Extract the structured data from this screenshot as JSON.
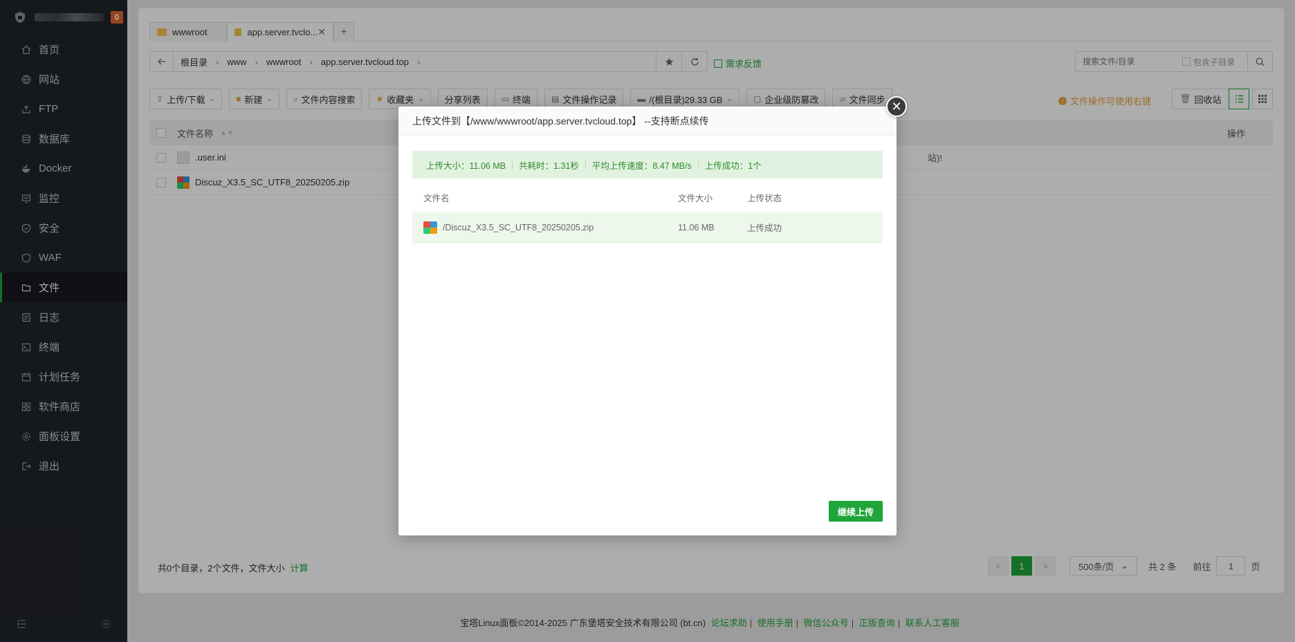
{
  "sidebar": {
    "badge": "0",
    "items": [
      {
        "label": "首页",
        "icon": "home-icon"
      },
      {
        "label": "网站",
        "icon": "globe-icon"
      },
      {
        "label": "FTP",
        "icon": "ftp-icon"
      },
      {
        "label": "数据库",
        "icon": "database-icon"
      },
      {
        "label": "Docker",
        "icon": "docker-icon"
      },
      {
        "label": "监控",
        "icon": "monitor-icon"
      },
      {
        "label": "安全",
        "icon": "shield-icon"
      },
      {
        "label": "WAF",
        "icon": "waf-icon"
      },
      {
        "label": "文件",
        "icon": "folder-icon",
        "active": true
      },
      {
        "label": "日志",
        "icon": "log-icon"
      },
      {
        "label": "终端",
        "icon": "terminal-icon"
      },
      {
        "label": "计划任务",
        "icon": "calendar-icon"
      },
      {
        "label": "软件商店",
        "icon": "store-icon"
      },
      {
        "label": "面板设置",
        "icon": "gear-icon"
      },
      {
        "label": "退出",
        "icon": "logout-icon"
      }
    ]
  },
  "tabs": [
    {
      "label": "wwwroot"
    },
    {
      "label": "app.server.tvclo..."
    }
  ],
  "path": {
    "crumbs": [
      "根目录",
      "www",
      "wwwroot",
      "app.server.tvcloud.top"
    ],
    "feedback": "需求反馈"
  },
  "search": {
    "placeholder": "搜索文件/目录",
    "subdir_label": "包含子目录"
  },
  "toolbar": {
    "upload": "上传/下载",
    "new": "新建",
    "content_search": "文件内容搜索",
    "favorites": "收藏夹",
    "share_list": "分享列表",
    "terminal": "终端",
    "op_log": "文件操作记录",
    "disk": "/(根目录)29.33 GB",
    "tamper": "企业级防篡改",
    "sync": "文件同步",
    "tip": "文件操作可使用右键",
    "recycle": "回收站"
  },
  "table": {
    "col_name": "文件名称",
    "col_op": "操作",
    "rows": [
      {
        "name": ".user.ini",
        "note": "站)!"
      },
      {
        "name": "Discuz_X3.5_SC_UTF8_20250205.zip",
        "note": ""
      }
    ]
  },
  "summary": {
    "text": "共0个目录，2个文件，文件大小",
    "calc": "计算"
  },
  "pager": {
    "prev": "<",
    "current": "1",
    "next": ">",
    "page_size": "500条/页",
    "total": "共 2 条",
    "goto_label": "前往",
    "goto_value": "1",
    "page_unit": "页"
  },
  "footer": {
    "copyright": "宝塔Linux面板©2014-2025 广东堡塔安全技术有限公司 (bt.cn)",
    "links": [
      "论坛求助",
      "使用手册",
      "微信公众号",
      "正版查询",
      "联系人工客服"
    ]
  },
  "modal": {
    "title": "上传文件到【/www/wwwroot/app.server.tvcloud.top】 --支持断点续传",
    "stats": {
      "size": "上传大小：11.06 MB",
      "time": "共耗时：1.31秒",
      "speed": "平均上传速度：8.47 MB/s",
      "success": "上传成功：1个"
    },
    "table": {
      "col_name": "文件名",
      "col_size": "文件大小",
      "col_status": "上传状态",
      "rows": [
        {
          "name": "/Discuz_X3.5_SC_UTF8_20250205.zip",
          "size": "11.06 MB",
          "status": "上传成功"
        }
      ]
    },
    "continue_label": "继续上传"
  },
  "colors": {
    "accent": "#20a53a",
    "sidebar_bg": "#20242a",
    "warning": "#e6a23c"
  }
}
